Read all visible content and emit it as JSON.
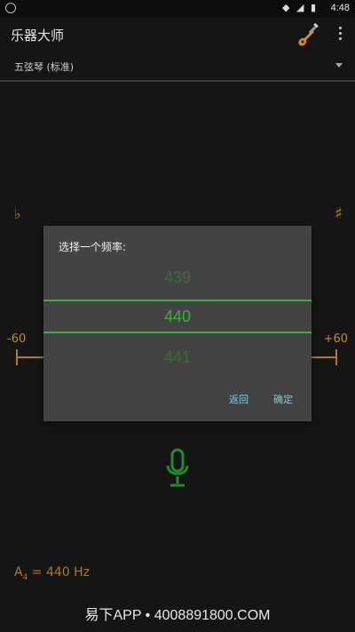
{
  "statusbar": {
    "time": "4:48",
    "icons": "◆ ◢ ▮"
  },
  "app": {
    "title": "乐器大师",
    "instrument": "五弦琴 (标准)"
  },
  "tuner": {
    "flat": "♭",
    "sharp": "♯",
    "min_label": "-60",
    "max_label": "+60",
    "reference_note": "A",
    "reference_octave": "4",
    "reference_value": " = 440 Hz"
  },
  "dialog": {
    "title": "选择一个频率:",
    "prev_value": "439",
    "current_value": "440",
    "next_value": "441",
    "cancel_label": "返回",
    "ok_label": "确定"
  },
  "watermark": "易下APP • 4008891800.COM",
  "colors": {
    "accent_green": "#3fae3f",
    "tuner_orange": "#b07a24",
    "dialog_bg": "#434343",
    "button_text": "#7ec9d8"
  }
}
